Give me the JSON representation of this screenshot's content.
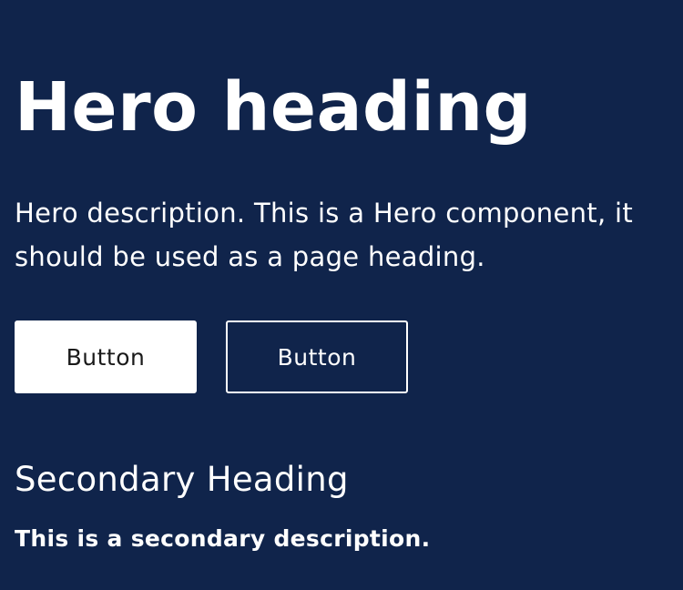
{
  "hero": {
    "heading": "Hero heading",
    "description": "Hero description. This is a Hero component, it should be used as a page heading.",
    "buttons": {
      "primary_label": "Button",
      "secondary_label": "Button"
    }
  },
  "secondary": {
    "heading": "Secondary Heading",
    "description": "This is a secondary description."
  },
  "colors": {
    "background": "#10244b",
    "text": "#ffffff",
    "primary_button_bg": "#ffffff",
    "primary_button_text": "#1a1a1a"
  }
}
